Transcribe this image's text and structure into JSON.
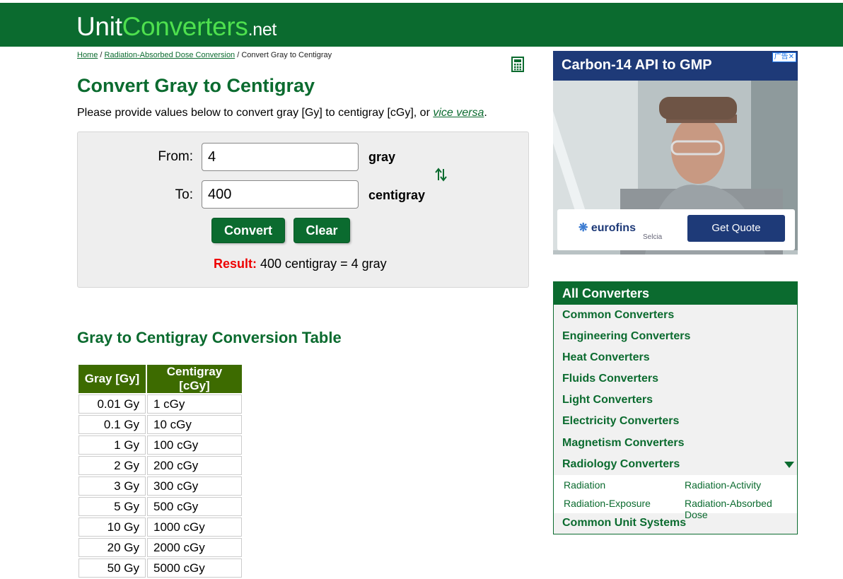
{
  "site": {
    "logo_unit": "Unit",
    "logo_converters": "Converters",
    "logo_net": ".net"
  },
  "breadcrumb": {
    "home": "Home",
    "category": "Radiation-Absorbed Dose Conversion",
    "sep": " / ",
    "current": "Convert Gray to Centigray"
  },
  "page": {
    "title": "Convert Gray to Centigray",
    "intro_text": "Please provide values below to convert gray [Gy] to centigray [cGy], or ",
    "intro_link": "vice versa",
    "intro_end": "."
  },
  "converter": {
    "from_label": "From:",
    "from_value": "4",
    "from_unit": "gray",
    "to_label": "To:",
    "to_value": "400",
    "to_unit": "centigray",
    "convert_label": "Convert",
    "clear_label": "Clear",
    "result_label": "Result:",
    "result_text": " 400 centigray = 4 gray"
  },
  "table": {
    "title": "Gray to Centigray Conversion Table",
    "headers": [
      "Gray [Gy]",
      "Centigray [cGy]"
    ],
    "rows": [
      [
        "0.01 Gy",
        "1 cGy"
      ],
      [
        "0.1 Gy",
        "10 cGy"
      ],
      [
        "1 Gy",
        "100 cGy"
      ],
      [
        "2 Gy",
        "200 cGy"
      ],
      [
        "3 Gy",
        "300 cGy"
      ],
      [
        "5 Gy",
        "500 cGy"
      ],
      [
        "10 Gy",
        "1000 cGy"
      ],
      [
        "20 Gy",
        "2000 cGy"
      ],
      [
        "50 Gy",
        "5000 cGy"
      ]
    ]
  },
  "ad": {
    "title": "Carbon-14 API to GMP",
    "close": "广告✕",
    "brand": "eurofins",
    "sub_brand": "Selcia",
    "cta": "Get Quote"
  },
  "sidebar": {
    "header": "All Converters",
    "items": [
      "Common Converters",
      "Engineering Converters",
      "Heat Converters",
      "Fluids Converters",
      "Light Converters",
      "Electricity Converters",
      "Magnetism Converters",
      "Radiology Converters"
    ],
    "radiology_sub": [
      "Radiation",
      "Radiation-Activity",
      "Radiation-Exposure",
      "Radiation-Absorbed Dose"
    ],
    "footer_item": "Common Unit Systems"
  },
  "colors": {
    "brand_green": "#0b6b2f",
    "logo_accent": "#4ee04e",
    "result_red": "#e00000",
    "ad_blue": "#1e3a78"
  },
  "icons": {
    "calculator": "calculator-icon",
    "swap": "swap-arrows-icon",
    "expand": "triangle-down-icon"
  }
}
